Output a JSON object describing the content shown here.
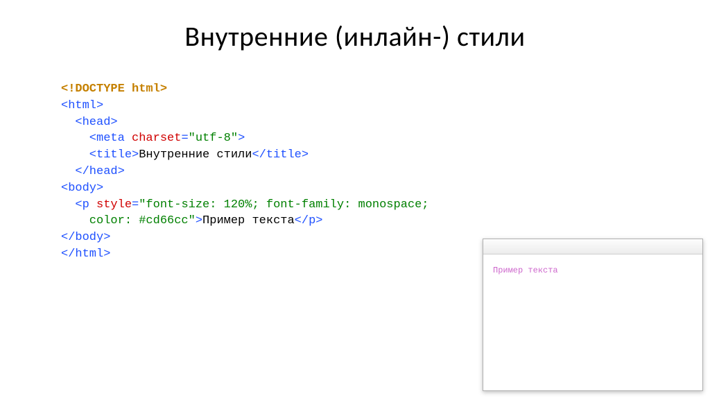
{
  "title": "Внутренние (инлайн-) стили",
  "code": {
    "l1a": "<!DOCTYPE",
    "l1b": " html>",
    "l2": "<html>",
    "l3": "  <head>",
    "l4a": "    <meta ",
    "l4b": "charset",
    "l4c": "=",
    "l4d": "\"utf-8\"",
    "l4e": ">",
    "l5a": "    <title>",
    "l5b": "Внутренние стили",
    "l5c": "</title>",
    "l6": "  </head>",
    "l7": "<body>",
    "l8a": "  <p ",
    "l8b": "style",
    "l8c": "=",
    "l8d": "\"font-size: 120%; font-family: monospace;",
    "l9a": "    color: #cd66cc\"",
    "l9b": ">",
    "l9c": "Пример текста",
    "l9d": "</p>",
    "l10": "</body>",
    "l11": "</html>"
  },
  "preview": {
    "text": "Пример текста"
  }
}
